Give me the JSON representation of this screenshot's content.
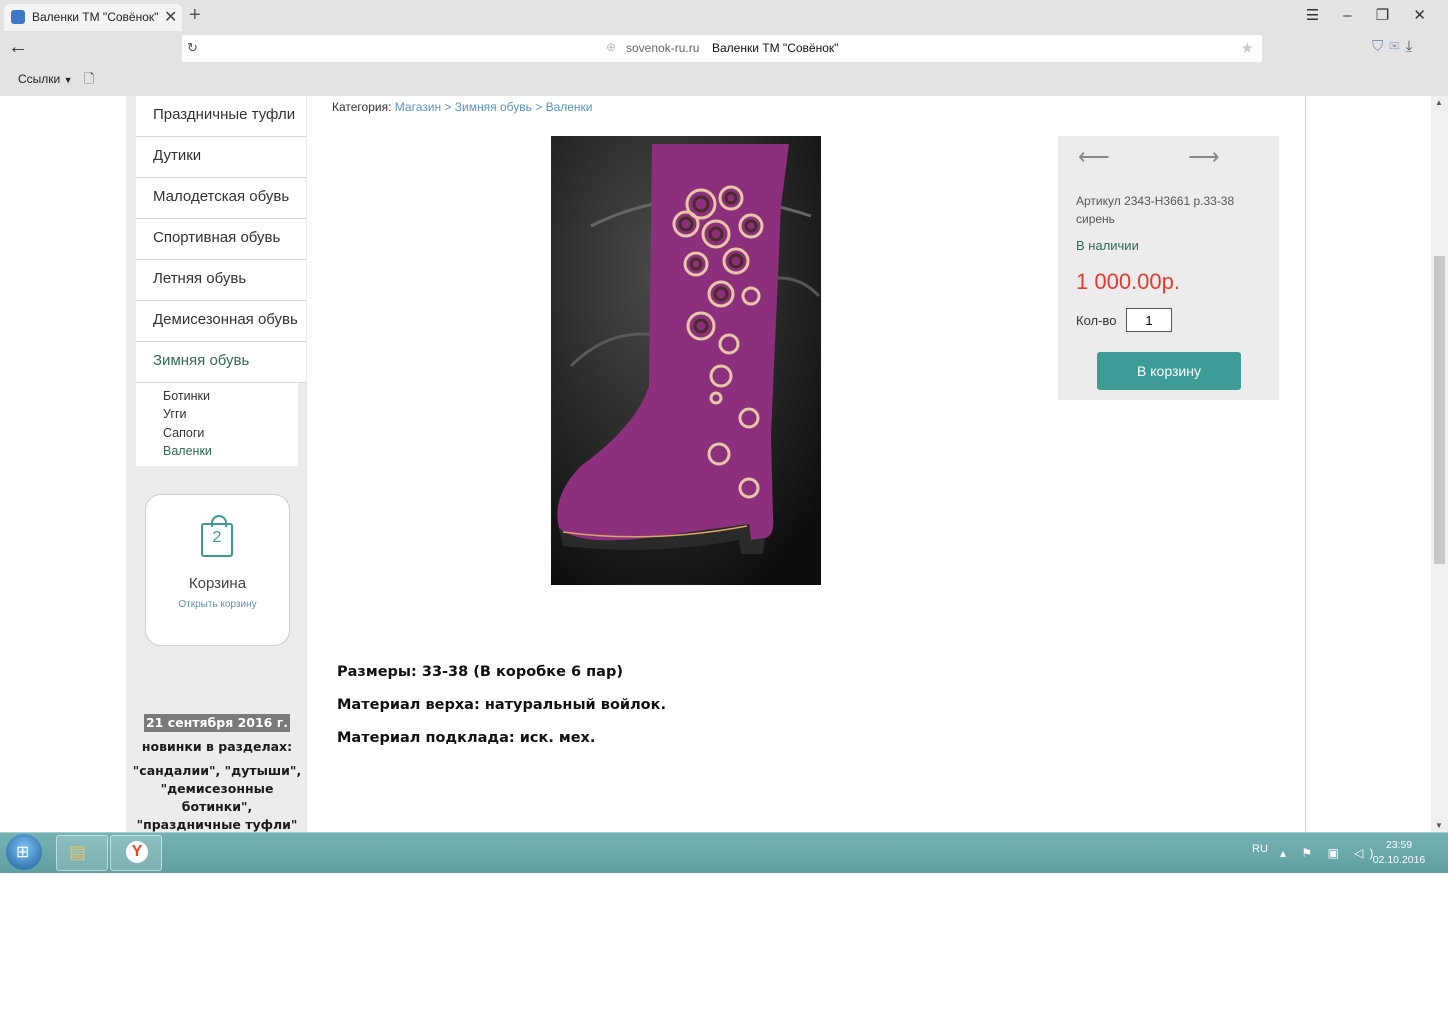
{
  "browser": {
    "tab_title": "Валенки ТМ \"Совёнок\"",
    "tab_close": "✕",
    "new_tab": "+",
    "domain": "sovenok-ru.ru",
    "page_title": "Валенки ТМ \"Совёнок\"",
    "bookmarks_label": "Ссылки",
    "window_controls": "☰ – ❐ ✕"
  },
  "sidebar": {
    "menu": [
      {
        "label": "Праздничные туфли"
      },
      {
        "label": "Дутики"
      },
      {
        "label": "Малодетская обувь"
      },
      {
        "label": "Спортивная обувь"
      },
      {
        "label": "Летняя обувь"
      },
      {
        "label": "Демисезонная обувь"
      },
      {
        "label": "Зимняя обувь"
      }
    ],
    "submenu": [
      {
        "label": "Ботинки"
      },
      {
        "label": "Угги"
      },
      {
        "label": "Сапоги"
      },
      {
        "label": "Валенки"
      }
    ],
    "cart": {
      "count": "2",
      "label": "Корзина",
      "open_link": "Открыть корзину"
    },
    "news": {
      "date": "21 сентября 2016 г.",
      "line1": "новинки в разделах:",
      "line2": "\"сандалии\", \"дутыши\", \"демисезонные ботинки\", \"праздничные туфли\""
    }
  },
  "breadcrumb": {
    "prefix": "Категория:",
    "items": [
      "Магазин",
      "Зимняя обувь",
      "Валенки"
    ],
    "separator": ">"
  },
  "product": {
    "article": "Артикул 2343-Н3661 р.33-38 сирень",
    "stock": "В наличии",
    "price": "1 000.00р.",
    "qty_label": "Кол-во",
    "qty_value": "1",
    "buy_label": "В корзину",
    "prev_arrow": "⟵",
    "next_arrow": "⟶"
  },
  "description": [
    "Размеры: 33-38 (В коробке 6 пар)",
    "Материал верха: натуральный войлок.",
    "Материал подклада: иск. мех."
  ],
  "taskbar": {
    "lang": "RU",
    "time": "23:59",
    "date": "02.10.2016"
  },
  "colors": {
    "accent": "#3e9c97",
    "price": "#e53a32",
    "link": "#5b93c0",
    "active_menu": "#2f6b4f",
    "boot": "#8c2f7c"
  }
}
